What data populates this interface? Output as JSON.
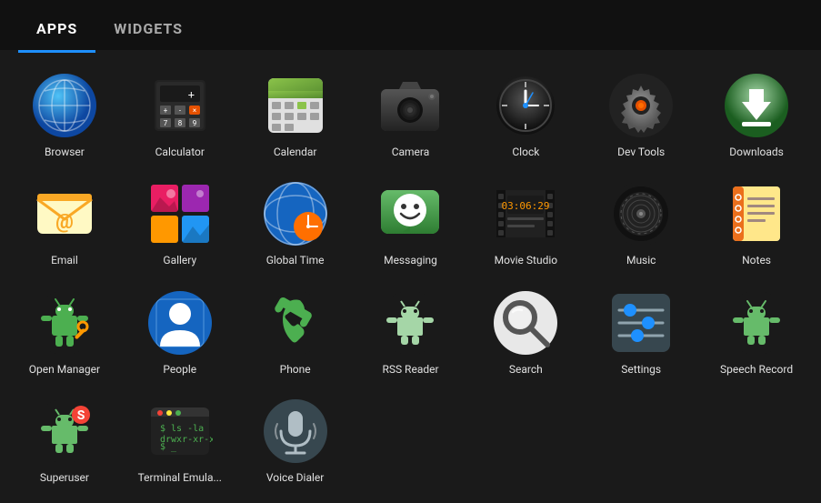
{
  "tabs": [
    {
      "label": "APPS",
      "active": true
    },
    {
      "label": "WIDGETS",
      "active": false
    }
  ],
  "apps": [
    {
      "name": "Browser",
      "icon": "browser"
    },
    {
      "name": "Calculator",
      "icon": "calculator"
    },
    {
      "name": "Calendar",
      "icon": "calendar"
    },
    {
      "name": "Camera",
      "icon": "camera"
    },
    {
      "name": "Clock",
      "icon": "clock"
    },
    {
      "name": "Dev Tools",
      "icon": "devtools"
    },
    {
      "name": "Downloads",
      "icon": "downloads"
    },
    {
      "name": "Email",
      "icon": "email"
    },
    {
      "name": "Gallery",
      "icon": "gallery"
    },
    {
      "name": "Global Time",
      "icon": "globaltime"
    },
    {
      "name": "Messaging",
      "icon": "messaging"
    },
    {
      "name": "Movie Studio",
      "icon": "moviestudio"
    },
    {
      "name": "Music",
      "icon": "music"
    },
    {
      "name": "Notes",
      "icon": "notes"
    },
    {
      "name": "Open Manager",
      "icon": "openmanager"
    },
    {
      "name": "People",
      "icon": "people"
    },
    {
      "name": "Phone",
      "icon": "phone"
    },
    {
      "name": "RSS Reader",
      "icon": "rssreader"
    },
    {
      "name": "Search",
      "icon": "search"
    },
    {
      "name": "Settings",
      "icon": "settings"
    },
    {
      "name": "Speech Record",
      "icon": "speechrecord"
    },
    {
      "name": "Superuser",
      "icon": "superuser"
    },
    {
      "name": "Terminal Emula...",
      "icon": "terminal"
    },
    {
      "name": "Voice Dialer",
      "icon": "voicedialer"
    }
  ],
  "colors": {
    "active_tab_indicator": "#1e90ff",
    "background": "#1a1a1a"
  }
}
